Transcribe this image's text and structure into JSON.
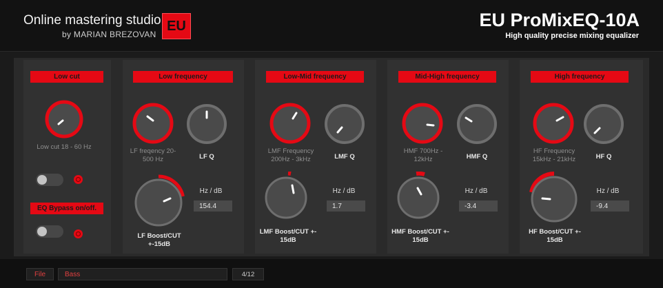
{
  "header": {
    "studio_title": "Online mastering studio",
    "studio_subtitle": "by MARIAN BREZOVAN",
    "logo_text": "EU",
    "product_title": "EU ProMixEQ-10A",
    "product_subtitle": "High quality precise mixing equalizer"
  },
  "colors": {
    "accent_red": "#e50914",
    "panel": "#313131",
    "knob_body": "#4a4a4a",
    "background": "#1b1b1b"
  },
  "low_cut": {
    "label": "Low cut",
    "knob_caption": "Low cut 18 - 60 Hz",
    "bypass_label": "EQ Bypass on/off."
  },
  "low": {
    "label": "Low frequency",
    "freq_caption": "LF freqency 20-500 Hz",
    "q_caption": "LF Q",
    "gain_caption": "LF Boost/CUT +-15dB",
    "hz_db_label": "Hz / dB",
    "value": "154.4"
  },
  "low_mid": {
    "label": "Low-Mid frequency",
    "freq_caption": "LMF Frequency 200Hz - 3kHz",
    "q_caption": "LMF Q",
    "gain_caption": "LMF Boost/CUT +- 15dB",
    "hz_db_label": "Hz / dB",
    "value": "1.7"
  },
  "mid_high": {
    "label": "Mid-High frequency",
    "freq_caption": "HMF 700Hz - 12kHz",
    "q_caption": "HMF Q",
    "gain_caption": "HMF Boost/CUT +- 15dB",
    "hz_db_label": "Hz / dB",
    "value": "-3.4"
  },
  "high": {
    "label": "High frequency",
    "freq_caption": "HF Frequency 15kHz - 21kHz",
    "q_caption": "HF Q",
    "gain_caption": "HF Boost/CUT +- 15dB",
    "hz_db_label": "Hz / dB",
    "value": "-9.4"
  },
  "footer": {
    "file_label": "File",
    "preset_name": "Bass",
    "page_count": "4/12"
  }
}
